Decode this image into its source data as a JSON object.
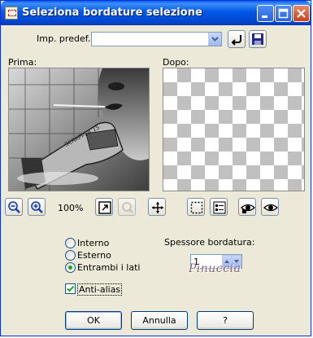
{
  "window": {
    "title": "Seleziona bordature selezione"
  },
  "preset": {
    "label": "Imp. predef.:",
    "value": ""
  },
  "preview": {
    "before_label": "Prima:",
    "after_label": "Dopo:"
  },
  "zoom": {
    "level": "100%"
  },
  "options": {
    "interno_label": "Interno",
    "esterno_label": "Esterno",
    "entrambi_label": "Entrambi i lati",
    "selected": "entrambi",
    "antialias_label": "Anti-alias",
    "antialias_checked": true
  },
  "width": {
    "label": "Spessore bordatura:",
    "value": "1"
  },
  "watermark": "Pinuccia",
  "buttons": {
    "ok": "OK",
    "cancel": "Annulla",
    "help": "?"
  },
  "colors": {
    "titlebar": "#0058e6",
    "dialog_bg": "#ece9d8",
    "radio_dot": "#21a121"
  }
}
